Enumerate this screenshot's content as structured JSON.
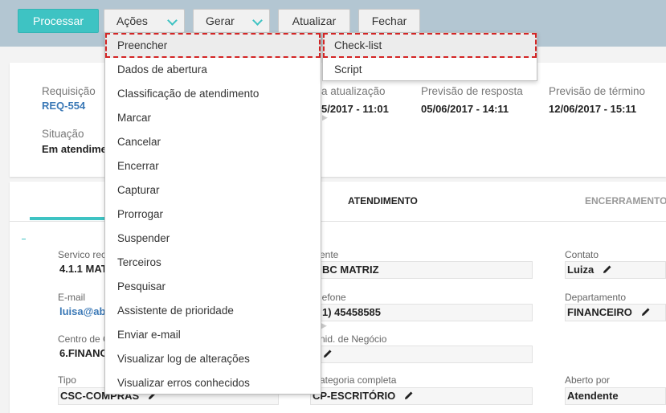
{
  "toolbar": {
    "process": "Processar",
    "actions": "Ações",
    "generate": "Gerar",
    "update": "Atualizar",
    "close": "Fechar"
  },
  "header_card": {
    "requisicao_label": "Requisição",
    "requisicao_value": "REQ-554",
    "situacao_label": "Situação",
    "situacao_value": "Em atendime",
    "ultima_label": "a atualização",
    "ultima_value": "5/2017 - 11:01",
    "prev_resposta_label": "Previsão de resposta",
    "prev_resposta_value": "05/06/2017 - 14:11",
    "prev_termino_label": "Previsão de término",
    "prev_termino_value": "12/06/2017 - 15:11"
  },
  "tabs": {
    "atendimento": "ATENDIMENTO",
    "encerramento": "ENCERRAMENTO"
  },
  "form": {
    "servico_label": "Servico rec",
    "servico_value": "4.1.1 MAT",
    "cliente_label": "ente",
    "cliente_value": "BC MATRIZ",
    "contato_label": "Contato",
    "contato_value": "Luiza",
    "email_label": "E-mail",
    "email_value": "luisa@ab",
    "telefone_label": "lefone",
    "telefone_value": "1) 45458585",
    "departamento_label": "Departamento",
    "departamento_value": "FINANCEIRO",
    "centro_label": "Centro de C",
    "centro_value": "6.FINANC",
    "unid_label": "nid. de Negócio",
    "tipo_label": "Tipo",
    "tipo_value": "CSC-COMPRAS",
    "categoria_label": "ategoria completa",
    "categoria_value": "CP-ESCRITÓRIO",
    "aberto_label": "Aberto por",
    "aberto_value": "Atendente"
  },
  "actions_menu": {
    "items": [
      "Preencher",
      "Dados de abertura",
      "Classificação de atendimento",
      "Marcar",
      "Cancelar",
      "Encerrar",
      "Capturar",
      "Prorrogar",
      "Suspender",
      "Terceiros",
      "Pesquisar",
      "Assistente de prioridade",
      "Enviar e-mail",
      "Visualizar log de alterações",
      "Visualizar erros conhecidos"
    ]
  },
  "submenu": {
    "items": [
      "Check-list",
      "Script"
    ]
  },
  "colors": {
    "accent": "#3ec3c3",
    "topbar": "#b3c6d2",
    "highlight_border": "#d32525",
    "link": "#3a78b6"
  }
}
